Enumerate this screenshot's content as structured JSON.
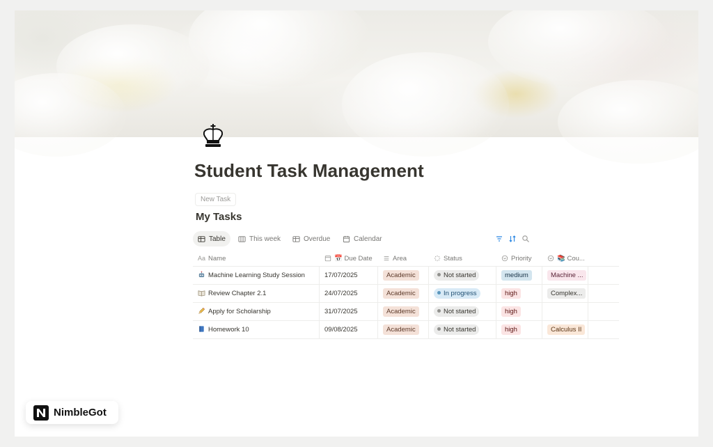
{
  "page": {
    "title": "Student Task Management",
    "new_task_button": "New Task",
    "section_title": "My Tasks",
    "icon": "chess-king-icon"
  },
  "views": {
    "tabs": [
      {
        "label": "Table",
        "icon": "table-icon",
        "active": true
      },
      {
        "label": "This week",
        "icon": "board-columns-icon",
        "active": false
      },
      {
        "label": "Overdue",
        "icon": "table-icon",
        "active": false
      },
      {
        "label": "Calendar",
        "icon": "calendar-icon",
        "active": false
      }
    ],
    "tools": [
      "filter-icon",
      "sort-icon",
      "search-icon"
    ]
  },
  "table": {
    "columns": [
      {
        "label": "Name",
        "icon": "text-aa-icon"
      },
      {
        "label": "📅 Due Date",
        "icon": "calendar-icon"
      },
      {
        "label": "Area",
        "icon": "list-icon"
      },
      {
        "label": "Status",
        "icon": "status-loader-icon"
      },
      {
        "label": "Priority",
        "icon": "select-circle-icon"
      },
      {
        "label": "📚 Cou...",
        "icon": "select-circle-icon"
      }
    ],
    "rows": [
      {
        "emoji": "robot-icon",
        "name": "Machine Learning Study Session",
        "due": "17/07/2025",
        "area": "Academic",
        "status": "Not started",
        "priority": "medium",
        "course": "Machine ..."
      },
      {
        "emoji": "open-book-icon",
        "name": "Review Chapter 2.1",
        "due": "24/07/2025",
        "area": "Academic",
        "status": "In progress",
        "priority": "high",
        "course": "Complex..."
      },
      {
        "emoji": "pencil-icon",
        "name": "Apply for Scholarship",
        "due": "31/07/2025",
        "area": "Academic",
        "status": "Not started",
        "priority": "high",
        "course": ""
      },
      {
        "emoji": "blue-book-icon",
        "name": "Homework 10",
        "due": "09/08/2025",
        "area": "Academic",
        "status": "Not started",
        "priority": "high",
        "course": "Calculus II"
      }
    ]
  },
  "colors": {
    "text": "#37352f",
    "muted": "#787774",
    "accent": "#2383e2",
    "not_started_dot": "#91918e",
    "in_progress_dot": "#5b97bd"
  },
  "watermark": {
    "brand": "NimbleGot"
  }
}
